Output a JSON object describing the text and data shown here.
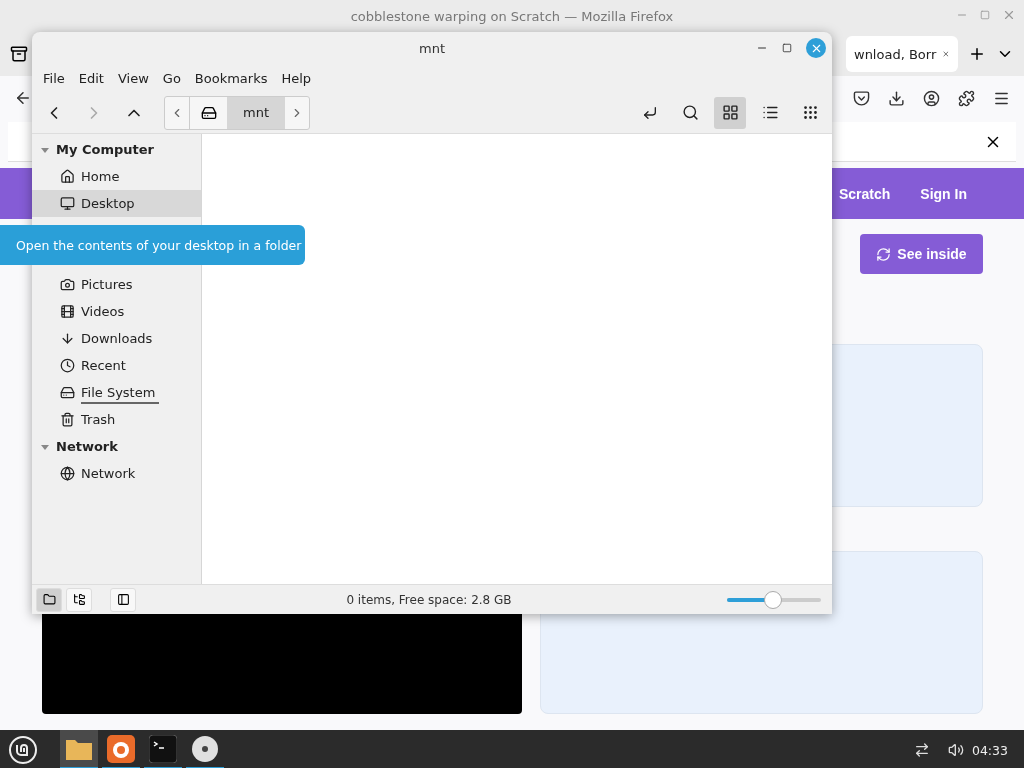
{
  "browser": {
    "title": "cobblestone warping on Scratch — Mozilla Firefox",
    "tab": {
      "label": "wnload, Borr"
    },
    "site_nav": [
      {
        "label": "Scratch"
      },
      {
        "label": "Sign In"
      }
    ],
    "see_inside": "See inside"
  },
  "file_manager": {
    "title": "mnt",
    "menu": [
      "File",
      "Edit",
      "View",
      "Go",
      "Bookmarks",
      "Help"
    ],
    "nav": [
      {
        "kind": "back",
        "disabled": false
      },
      {
        "kind": "forward",
        "disabled": true
      },
      {
        "kind": "up",
        "disabled": false
      }
    ],
    "breadcrumb": [
      {
        "label": "mnt",
        "selected": true
      }
    ],
    "views": [
      {
        "kind": "icons",
        "selected": true
      },
      {
        "kind": "list",
        "selected": false
      },
      {
        "kind": "compact",
        "selected": false
      }
    ],
    "sidebar": [
      {
        "label": "My Computer",
        "expanded": true,
        "children": [
          {
            "label": "Home",
            "kind": "home",
            "selected": false
          },
          {
            "label": "Desktop",
            "kind": "desktop",
            "selected": true
          },
          {
            "label": "Pictures",
            "kind": "pictures",
            "selected": false
          },
          {
            "label": "Videos",
            "kind": "videos",
            "selected": false
          },
          {
            "label": "Downloads",
            "kind": "downloads",
            "selected": false
          },
          {
            "label": "Recent",
            "kind": "recent",
            "selected": false
          },
          {
            "label": "File System",
            "kind": "drive",
            "selected": false,
            "level": 1
          },
          {
            "label": "Trash",
            "kind": "trash",
            "selected": false
          }
        ]
      },
      {
        "label": "Network",
        "expanded": true,
        "children": [
          {
            "label": "Network",
            "kind": "network",
            "selected": false
          }
        ]
      }
    ],
    "status": "0 items, Free space: 2.8 GB",
    "panes": [
      {
        "kind": "places",
        "selected": true
      },
      {
        "kind": "tree",
        "selected": false
      }
    ],
    "zoom": {
      "level": 0.49
    }
  },
  "tooltip": "Open the contents of your desktop in a folder",
  "taskbar": {
    "apps": [
      {
        "kind": "files",
        "active": true,
        "running": true
      },
      {
        "kind": "firefox",
        "active": false,
        "running": true
      },
      {
        "kind": "terminal",
        "active": false,
        "running": true
      },
      {
        "kind": "disc",
        "active": false,
        "running": true
      }
    ],
    "clock": "04:33"
  }
}
